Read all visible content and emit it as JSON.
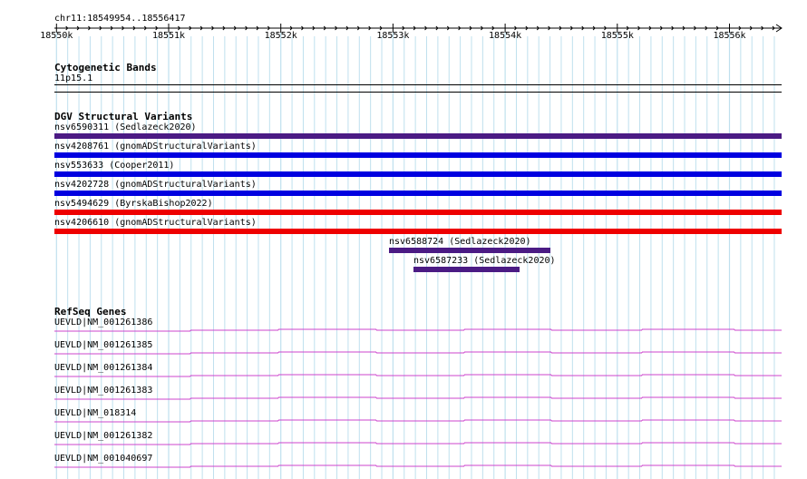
{
  "window": {
    "title": ""
  },
  "ruler": {
    "coordinate": "chr11:18549954..18556417",
    "ticks": [
      "18550k",
      "18551k",
      "18552k",
      "18553k",
      "18554k",
      "18555k",
      "18556k"
    ]
  },
  "cytobands": {
    "title": "Cytogenetic Bands",
    "band": "11p15.1"
  },
  "dgv": {
    "title": "DGV Structural Variants",
    "items": [
      {
        "label": "nsv6590311 (Sedlazeck2020)",
        "color": "#4b1b84"
      },
      {
        "label": "nsv4208761 (gnomADStructuralVariants)",
        "color": "#0000e0"
      },
      {
        "label": "nsv553633 (Cooper2011)",
        "color": "#0000e0"
      },
      {
        "label": "nsv4202728 (gnomADStructuralVariants)",
        "color": "#0000e0"
      },
      {
        "label": "nsv5494629 (ByrskaBishop2022)",
        "color": "#ee0000"
      },
      {
        "label": "nsv4206610 (gnomADStructuralVariants)",
        "color": "#ee0000"
      },
      {
        "label": "nsv6588724 (Sedlazeck2020)",
        "color": "#4b1b84"
      },
      {
        "label": "nsv6587233 (Sedlazeck2020)",
        "color": "#4b1b84"
      }
    ]
  },
  "refseq": {
    "title": "RefSeq Genes",
    "color": "#cc44cc",
    "genes": [
      {
        "label": "UEVLD|NM_001261386"
      },
      {
        "label": "UEVLD|NM_001261385"
      },
      {
        "label": "UEVLD|NM_001261384"
      },
      {
        "label": "UEVLD|NM_001261383"
      },
      {
        "label": "UEVLD|NM_018314"
      },
      {
        "label": "UEVLD|NM_001261382"
      },
      {
        "label": "UEVLD|NM_001040697"
      }
    ]
  },
  "colors": {
    "grid": "#bfe0ee",
    "text": "#000000"
  }
}
